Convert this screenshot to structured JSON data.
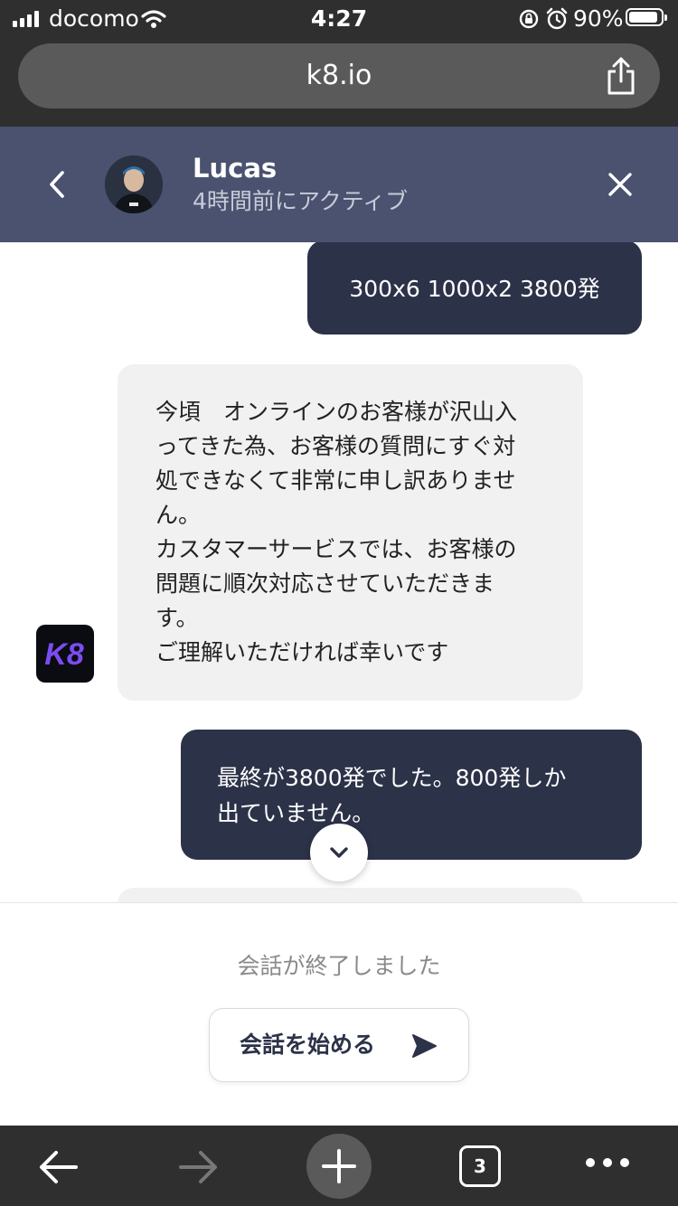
{
  "status_bar": {
    "carrier": "docomo",
    "time": "4:27",
    "battery_percent": "90%",
    "battery_level": 0.9,
    "icons": [
      "signal-icon",
      "wifi-icon",
      "rotation-lock-icon",
      "alarm-icon",
      "battery-icon"
    ]
  },
  "browser": {
    "url": "k8.io",
    "tab_count": "3",
    "icons": [
      "share-icon",
      "back-arrow-icon",
      "forward-arrow-icon",
      "plus-icon",
      "more-icon"
    ]
  },
  "chat_header": {
    "name": "Lucas",
    "status": "4時間前にアクティブ",
    "icons": [
      "chevron-left-icon",
      "close-icon"
    ]
  },
  "messages": [
    {
      "direction": "out",
      "text": "300x6 1000x2 3800発"
    },
    {
      "direction": "in",
      "sender_logo": "K8",
      "text": "今頃　オンラインのお客様が沢山入\nってきた為、お客様の質問にすぐ対\n処できなくて非常に申し訳ありませ\nん。\nカスタマーサービスでは、お客様の\n問題に順次対応させていただきま\nす。\nご理解いただければ幸いです"
    },
    {
      "direction": "out",
      "text": "最終が3800発でした。800発しか\n出ていません。"
    }
  ],
  "footer": {
    "ended_text": "会話が終了しました",
    "start_button_label": "会話を始める"
  },
  "colors": {
    "header_bg": "#4a5270",
    "outgoing_bubble": "#2c3248",
    "incoming_bubble": "#f1f1f1",
    "browser_chrome": "#2f2f2f",
    "k8_logo_purple": "#7b4df0"
  }
}
